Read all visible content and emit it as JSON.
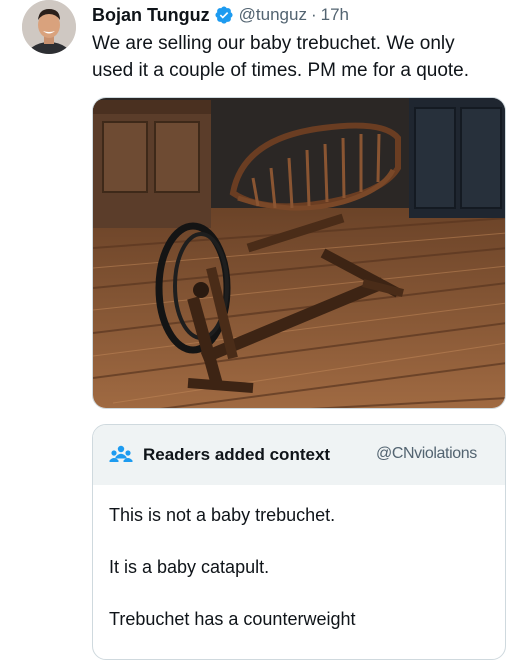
{
  "tweet": {
    "author_name": "Bojan Tunguz",
    "handle": "@tunguz",
    "separator": "·",
    "time": "17h",
    "text": "We are selling our baby trebuchet. We only\nused it a couple of times. PM me for a quote.",
    "verified_icon": "verified-badge-icon"
  },
  "community_note": {
    "title": "Readers added context",
    "source": "@CNviolations",
    "icon": "people-icon",
    "lines": [
      "This is not a baby trebuchet.",
      "It is a baby catapult.",
      "Trebuchet has a counterweight"
    ]
  },
  "colors": {
    "text_primary": "#0f1419",
    "text_secondary": "#536471",
    "verified_blue": "#1d9bf0",
    "note_icon_blue": "#1d9bf0",
    "note_header_bg": "#eff3f4",
    "border": "#cfd9de"
  }
}
